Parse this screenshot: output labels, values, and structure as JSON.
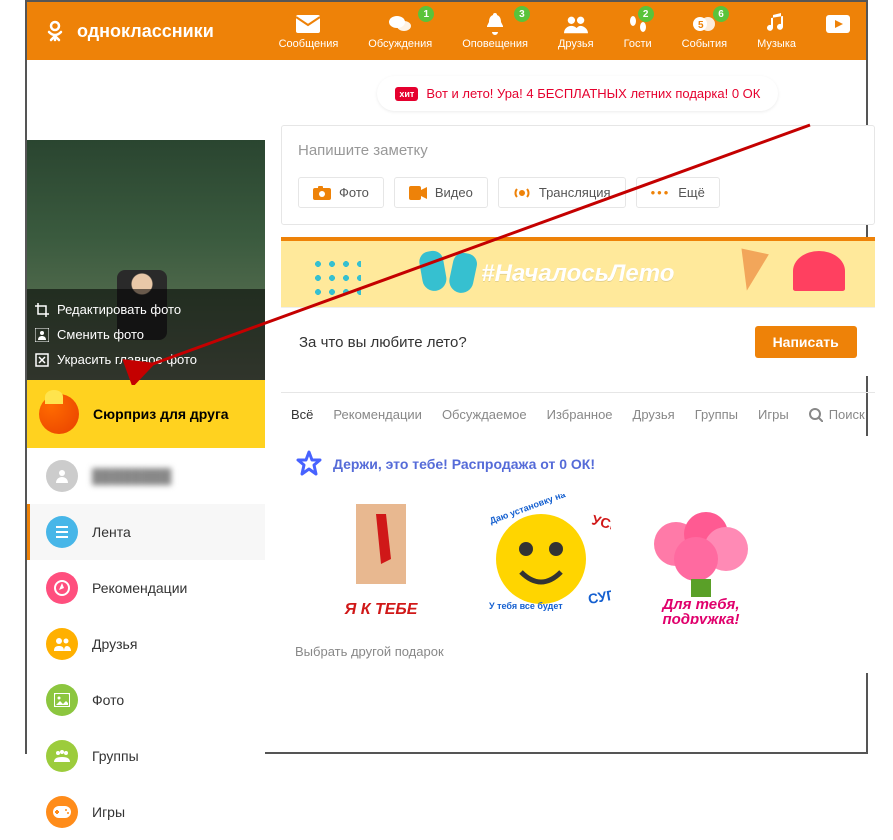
{
  "header": {
    "site_name": "одноклассники",
    "nav": [
      {
        "label": "Сообщения",
        "icon": "mail",
        "badge": null
      },
      {
        "label": "Обсуждения",
        "icon": "chat",
        "badge": "1"
      },
      {
        "label": "Оповещения",
        "icon": "bell",
        "badge": "3"
      },
      {
        "label": "Друзья",
        "icon": "friends",
        "badge": null
      },
      {
        "label": "Гости",
        "icon": "footprints",
        "badge": "2"
      },
      {
        "label": "События",
        "icon": "coins",
        "badge": "6"
      },
      {
        "label": "Музыка",
        "icon": "music",
        "badge": null
      }
    ]
  },
  "profile_photo": {
    "edit": "Редактировать фото",
    "change": "Сменить фото",
    "decorate": "Украсить главное фото"
  },
  "surprise": "Сюрприз для друга",
  "sidebar_nav": [
    {
      "label": "",
      "color": "c-gray"
    },
    {
      "label": "Лента",
      "color": "c-blue",
      "active": true
    },
    {
      "label": "Рекомендации",
      "color": "c-pink"
    },
    {
      "label": "Друзья",
      "color": "c-yel"
    },
    {
      "label": "Фото",
      "color": "c-grn"
    },
    {
      "label": "Группы",
      "color": "c-lime"
    },
    {
      "label": "Игры",
      "color": "c-orng"
    }
  ],
  "promo": {
    "hit": "хит",
    "text": "Вот и лето! Ура! 4 БЕСПЛАТНЫХ летних подарка! 0 ОК"
  },
  "note": {
    "placeholder": "Напишите заметку",
    "photo": "Фото",
    "video": "Видео",
    "stream": "Трансляция",
    "more": "Ещё"
  },
  "summer": {
    "tag": "#НачалосьЛето",
    "question": "За что вы любите лето?",
    "write": "Написать"
  },
  "tabs": {
    "all": "Всё",
    "rec": "Рекомендации",
    "disc": "Обсуждаемое",
    "fav": "Избранное",
    "friends": "Друзья",
    "groups": "Группы",
    "games": "Игры",
    "search": "Поиск"
  },
  "gift": {
    "headline": "Держи, это тебе! Распродажа от 0 ОК!",
    "select_other": "Выбрать другой подарок",
    "items": [
      "Я К ТЕБЕ",
      "УСПЕХ! СУПЕР!",
      "Для тебя, подружка!"
    ]
  }
}
